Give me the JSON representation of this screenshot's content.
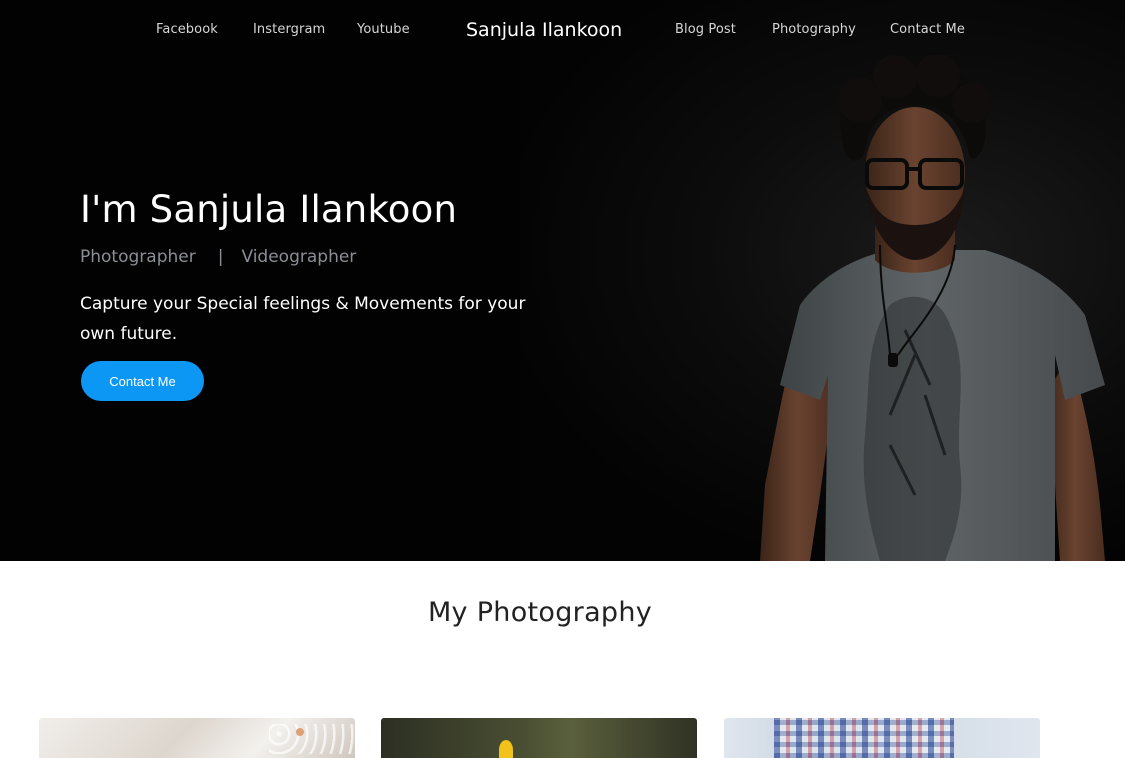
{
  "nav": {
    "left_links": [
      "Facebook",
      "Instergram",
      "Youtube"
    ],
    "brand": "Sanjula Ilankoon",
    "right_links": [
      "Blog Post",
      "Photography",
      "Contact Me"
    ]
  },
  "hero": {
    "title": "I'm Sanjula Ilankoon",
    "role_1": "Photographer",
    "separator": "|",
    "role_2": "Videographer",
    "tagline": "Capture your Special feelings & Movements for your own future.",
    "cta_label": "Contact Me"
  },
  "photography": {
    "title": "My Photography"
  },
  "colors": {
    "hero_background": "#020202",
    "accent": "#0d97f5",
    "muted_text": "#8a8f96"
  }
}
